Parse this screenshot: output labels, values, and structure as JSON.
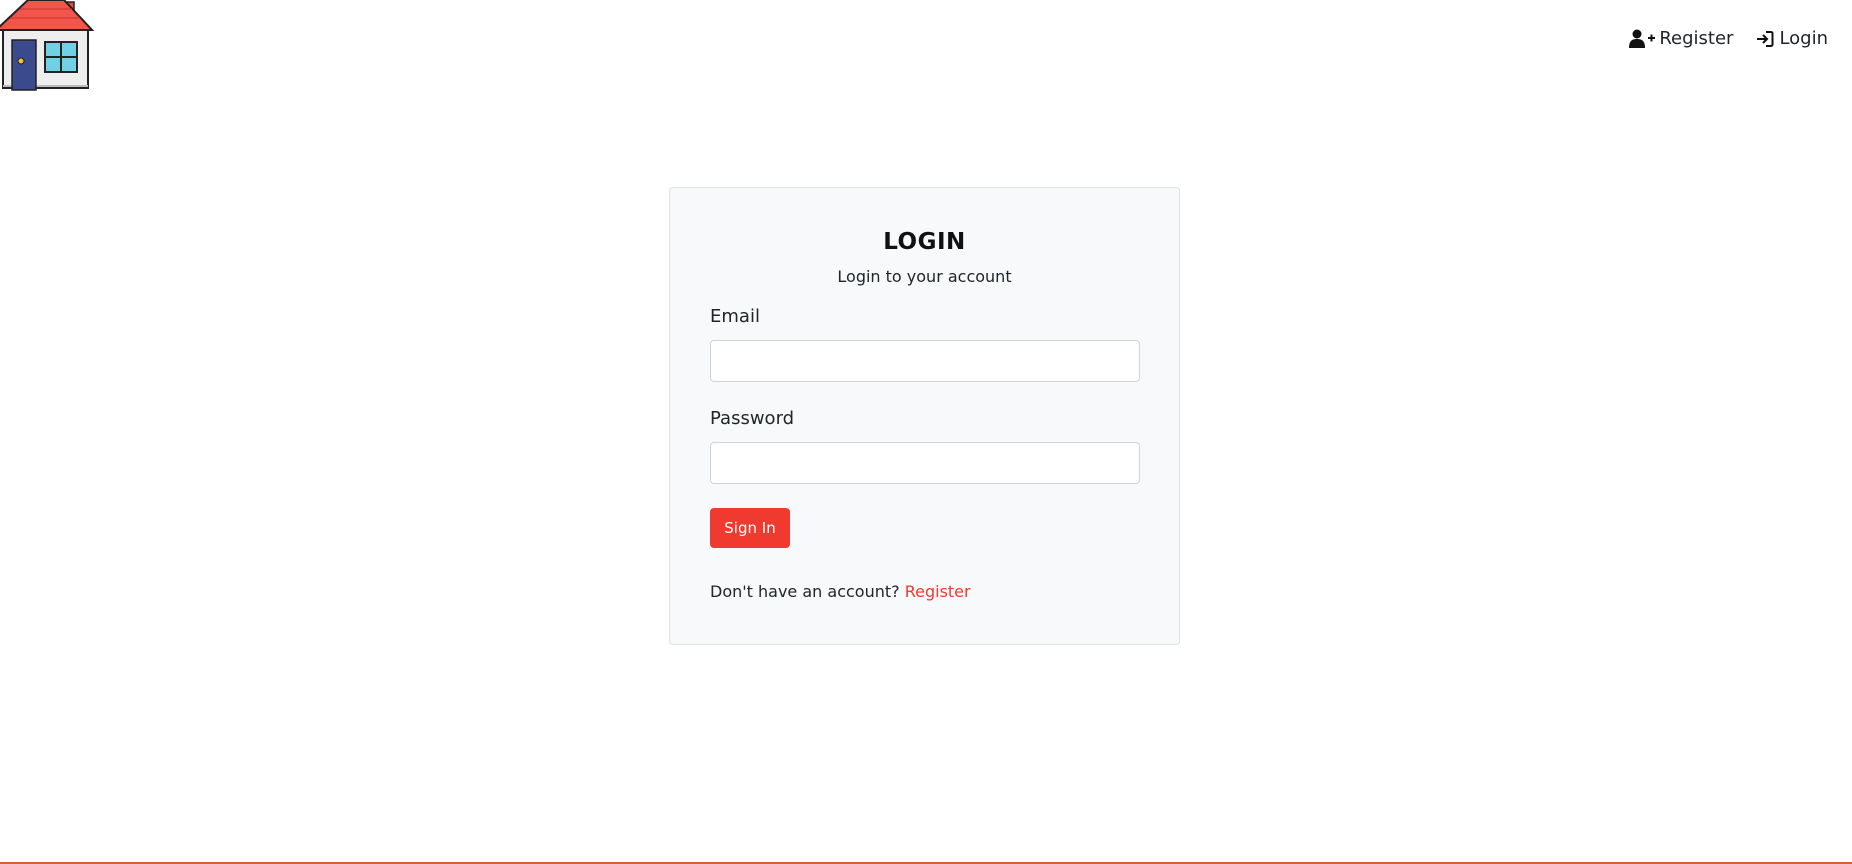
{
  "header": {
    "logo_icon": "house-icon",
    "nav": {
      "register_label": "Register",
      "register_icon": "user-plus-icon",
      "login_label": "Login",
      "login_icon": "sign-in-icon"
    }
  },
  "card": {
    "title": "LOGIN",
    "subtitle": "Login to your account",
    "email_label": "Email",
    "email_value": "",
    "password_label": "Password",
    "password_value": "",
    "submit_label": "Sign In",
    "footer_prompt": "Don't have an account?",
    "footer_link": "Register"
  },
  "colors": {
    "accent": "#f03a2f",
    "card_background": "#f8f9fa",
    "bottom_border": "#e8563a"
  }
}
